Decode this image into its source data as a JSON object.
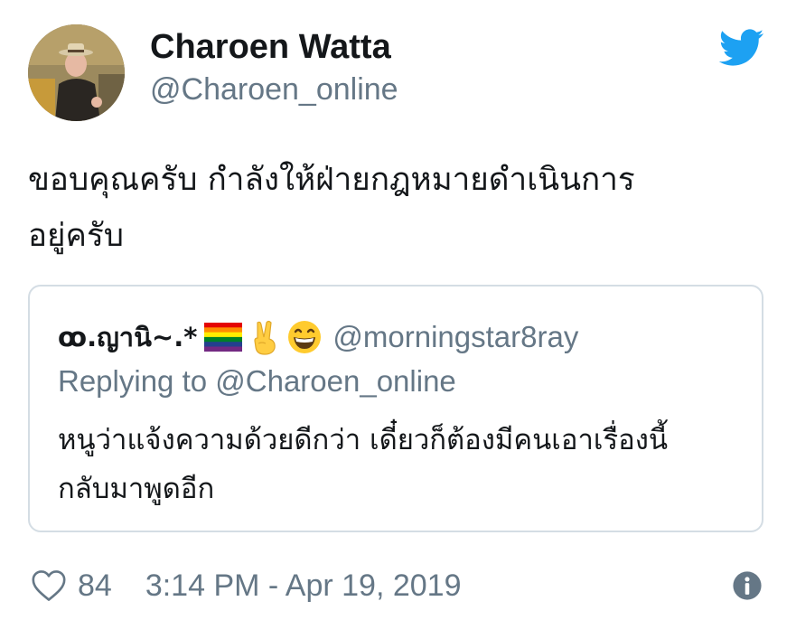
{
  "author": {
    "name": "Charoen Watta",
    "handle": "@Charoen_online"
  },
  "tweet": {
    "text_line1": "ขอบคุณครับ กำลังให้ฝ่ายกฎหมายดำเนินการ",
    "text_line2": "อยู่ครับ"
  },
  "quoted_tweet": {
    "name": "ꝏ.ญานิ~.*",
    "emojis": [
      "rainbow-flag-icon",
      "victory-hand-icon",
      "grinning-face-icon"
    ],
    "handle": "@morningstar8ray",
    "replying_to": "Replying to @Charoen_online",
    "text_line1": "หนูว่าแจ้งความด้วยดีกว่า เดี๋ยวก็ต้องมีคนเอาเรื่องนี้",
    "text_line2": "กลับมาพูดอีก"
  },
  "footer": {
    "like_count": "84",
    "timestamp": "3:14 PM - Apr 19, 2019"
  },
  "icons": {
    "brand": "twitter-bird-icon",
    "like": "heart-icon",
    "info": "info-icon"
  },
  "colors": {
    "twitter_blue": "#1da1f2",
    "secondary_text": "#657786",
    "primary_text": "#14171a",
    "card_border": "#d4dde4"
  }
}
